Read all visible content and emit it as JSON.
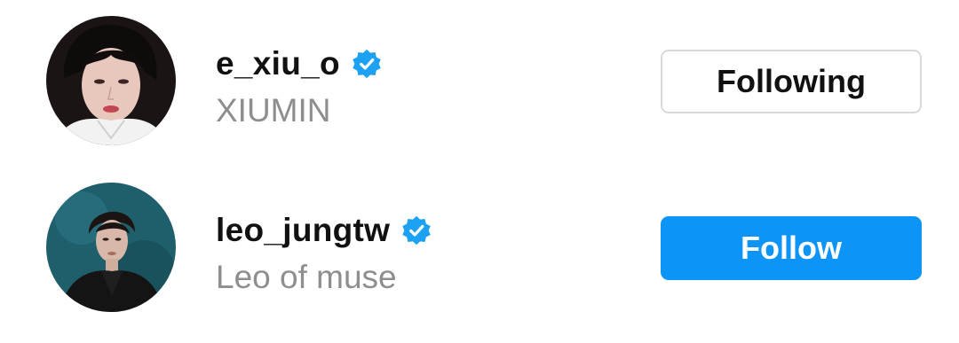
{
  "suggestions": [
    {
      "username": "e_xiu_o",
      "full_name": "XIUMIN",
      "verified": true,
      "button_label": "Following",
      "button_state": "following"
    },
    {
      "username": "leo_jungtw",
      "full_name": "Leo of muse",
      "verified": true,
      "button_label": "Follow",
      "button_state": "follow"
    }
  ],
  "colors": {
    "follow_button": "#0c95f6",
    "verified_badge": "#1da1f2",
    "secondary_text": "#8e8e8e",
    "following_border": "#d9d9d9"
  }
}
